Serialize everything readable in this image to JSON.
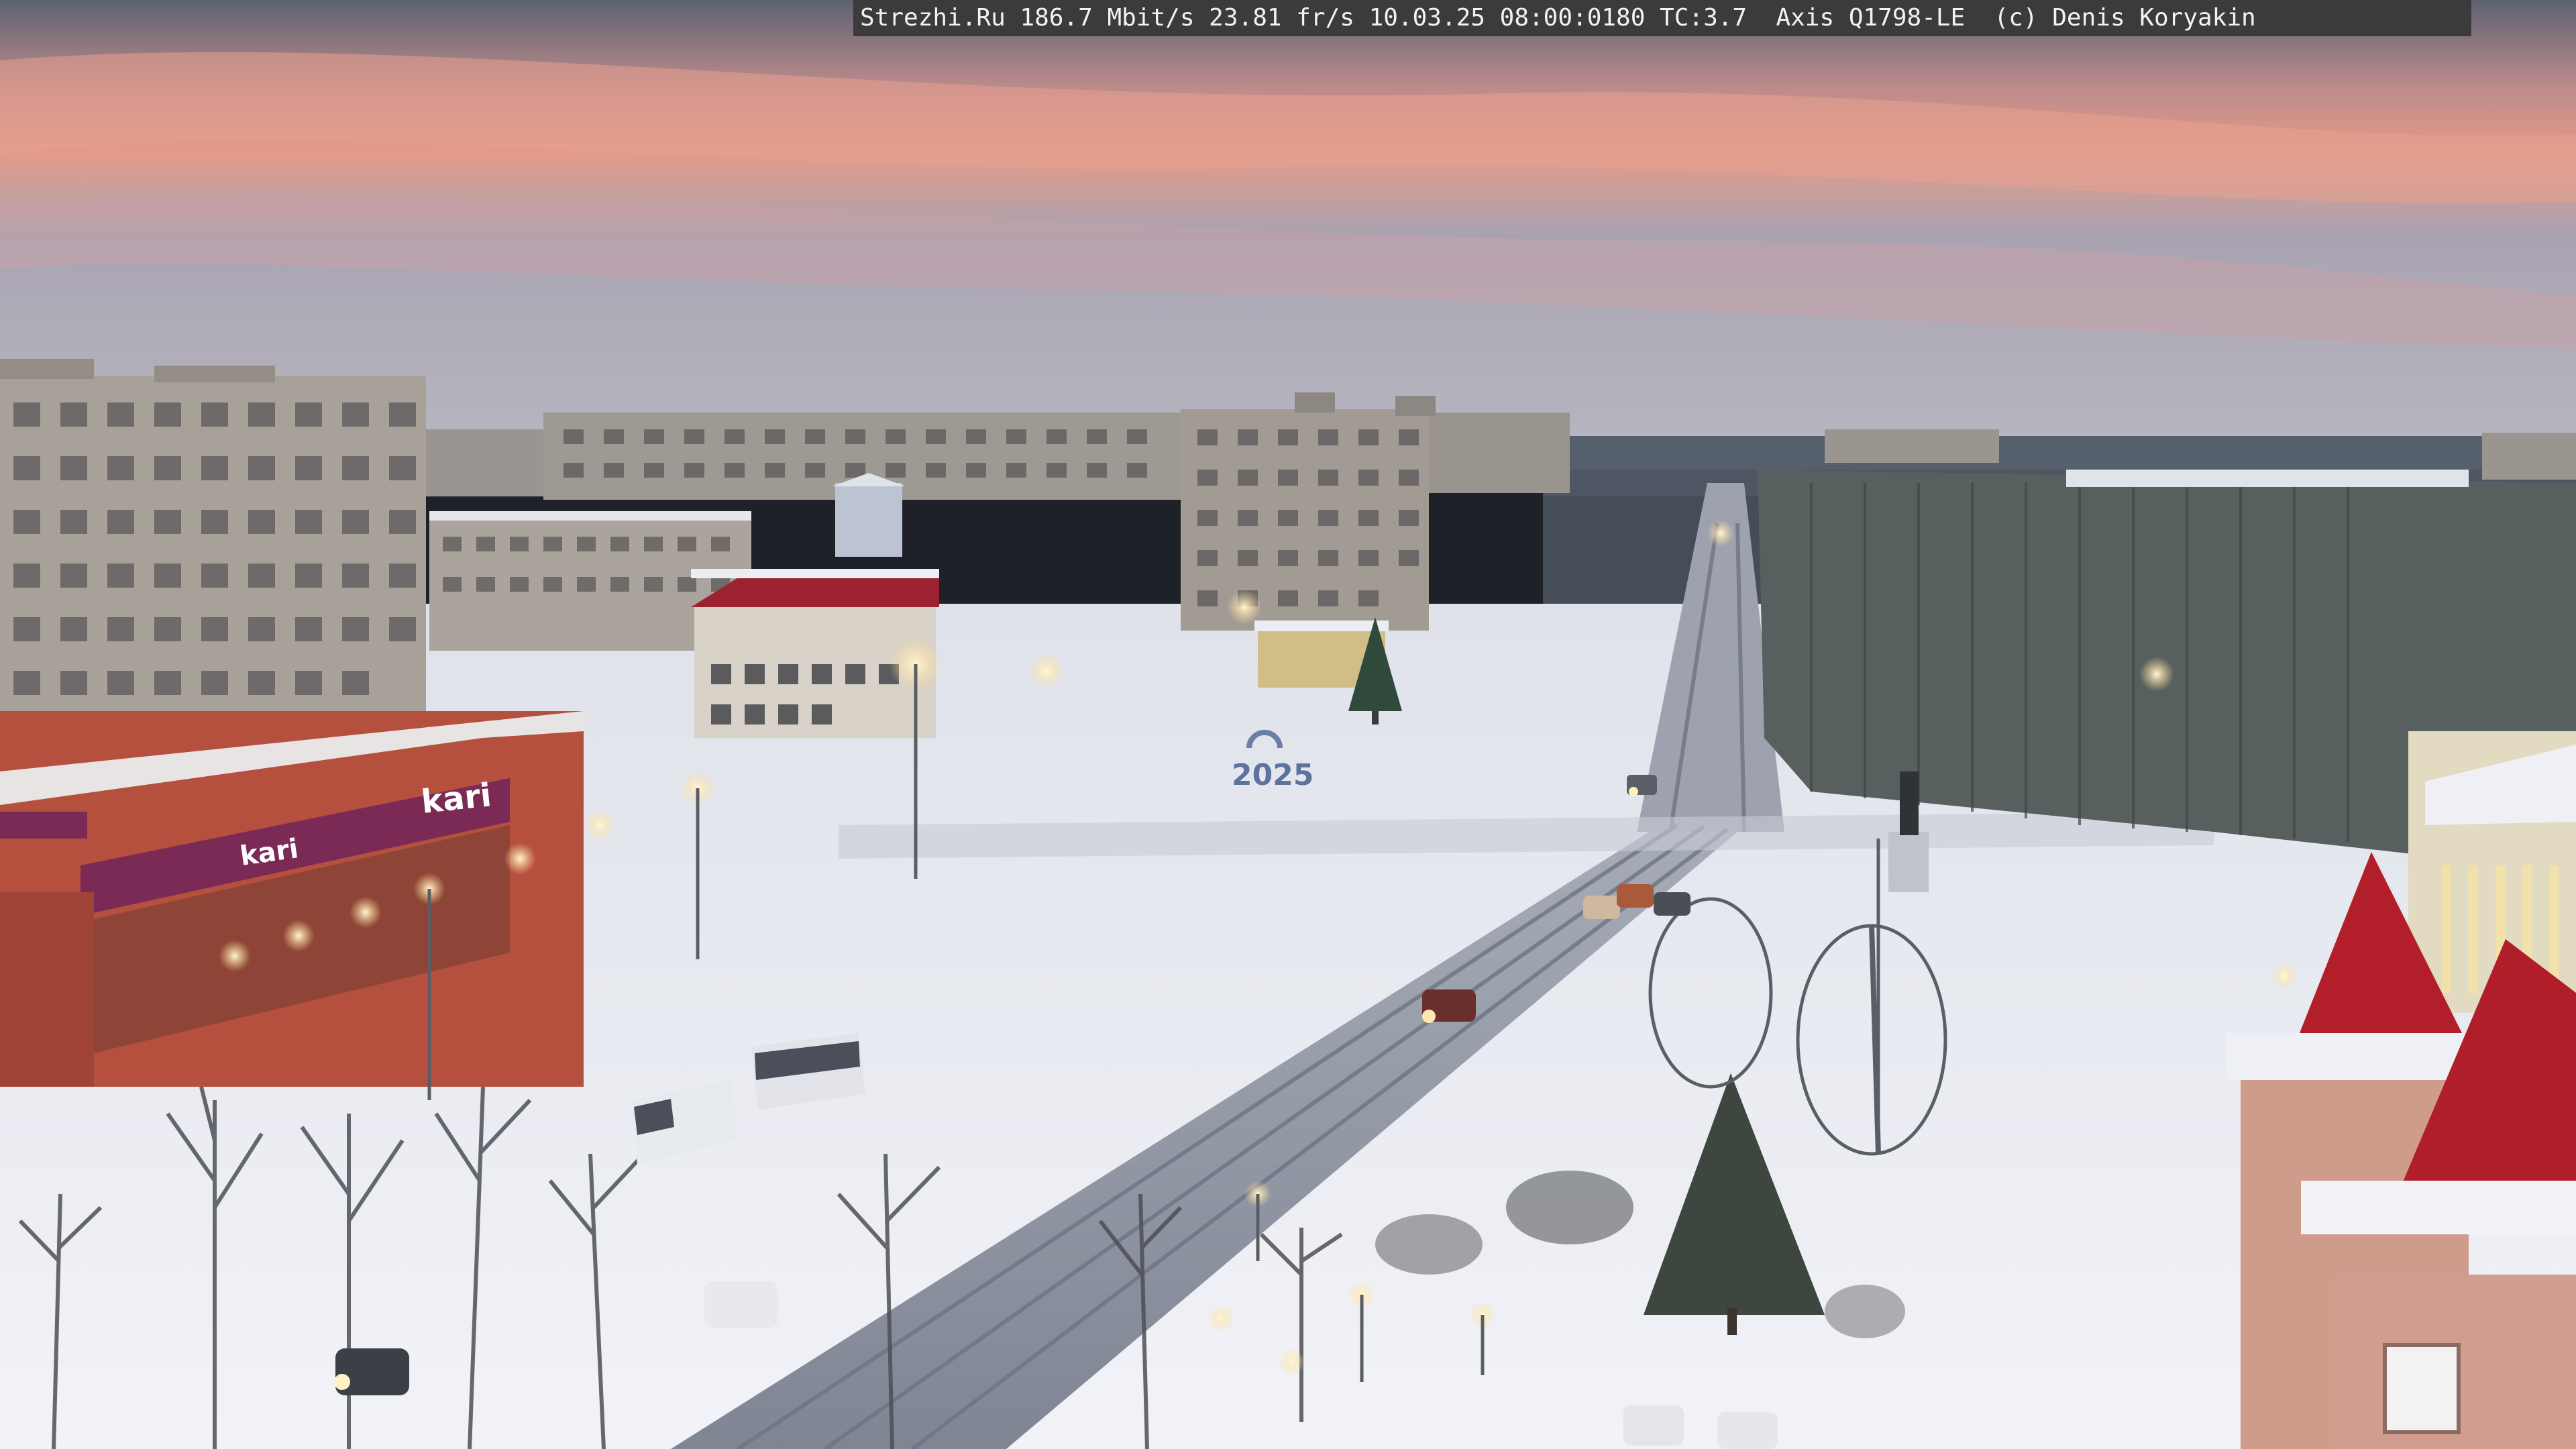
{
  "camera_overlay": {
    "text": "Strezhi.Ru 186.7 Mbit/s 23.81 fr/s 10.03.25 08:00:0180 TC:3.7  Axis Q1798-LE  (c) Denis Koryakin"
  },
  "scene": {
    "monument_year": "2025",
    "store_sign_left": "kari",
    "store_sign_small": "kari",
    "colors": {
      "sky_top": "#5c6272",
      "sky_glow": "#e59a88",
      "sky_horizon": "#b9b8c2",
      "snow": "#eef0f6",
      "snow_shadow": "#cfd3df",
      "road": "#8f95a2",
      "building_panel": "#a8a29c",
      "store_facade": "#b5503f",
      "store_band": "#7b2a55",
      "roof_red": "#b0202a",
      "tree_dark": "#3d463f"
    }
  }
}
